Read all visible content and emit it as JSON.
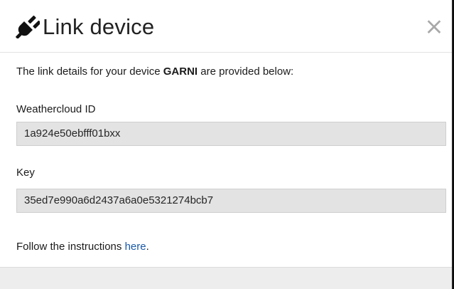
{
  "dialog": {
    "title": "Link device",
    "close_glyph": "×",
    "header_icon": "plug-icon",
    "close_icon": "close-icon"
  },
  "intro": {
    "prefix": "The link details for your device ",
    "device_name": "GARNI",
    "suffix": " are provided below:"
  },
  "fields": {
    "weathercloud_id": {
      "label": "Weathercloud ID",
      "value": "1a924e50ebfff01bxx"
    },
    "key": {
      "label": "Key",
      "value": "35ed7e990a6d2437a6a0e5321274bcb7"
    }
  },
  "instructions": {
    "prefix": "Follow the instructions ",
    "link_text": "here",
    "suffix": "."
  },
  "colors": {
    "link": "#1a5aa8",
    "field_background": "#e3e3e3",
    "footer_background": "#ededed"
  }
}
